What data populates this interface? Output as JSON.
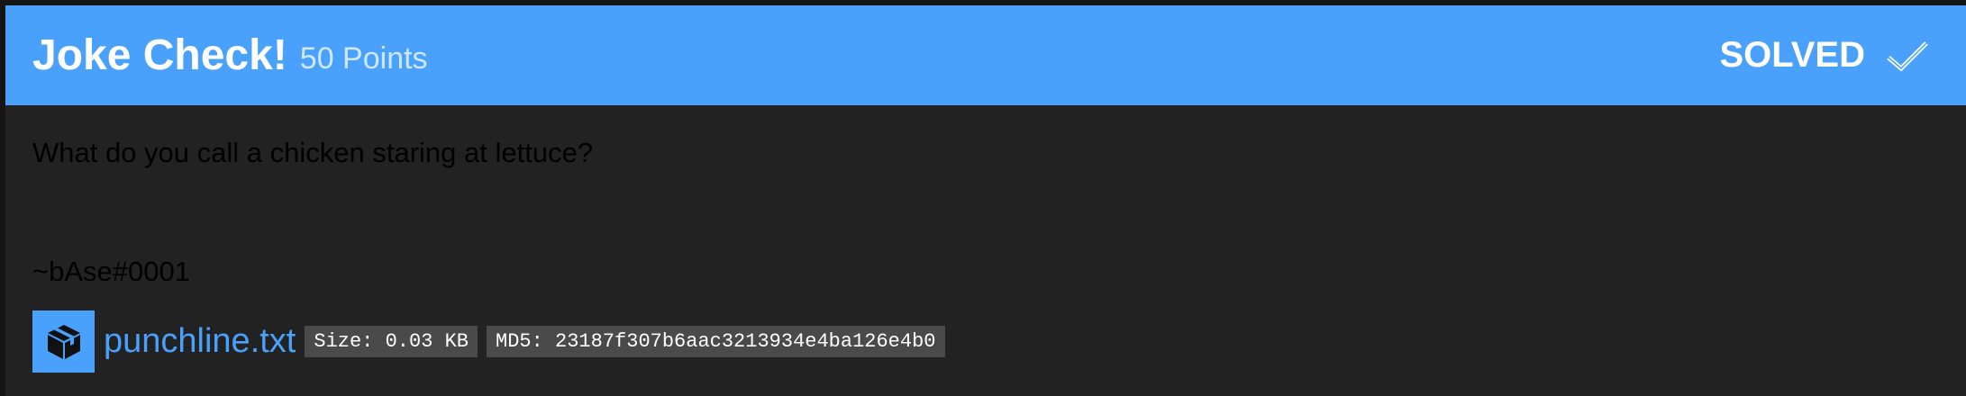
{
  "challenge": {
    "title": "Joke Check!",
    "points": "50 Points",
    "status": "SOLVED",
    "description": "What do you call a chicken staring at lettuce?",
    "author": "~bAse#0001"
  },
  "file": {
    "name": "punchline.txt",
    "size": "Size: 0.03 KB",
    "md5": "MD5: 23187f307b6aac3213934e4ba126e4b0"
  },
  "icons": {
    "status": "checkmark-icon",
    "file": "package-box-icon"
  },
  "colors": {
    "header": "#4aa1fb",
    "body": "#222222",
    "link": "#4aa1fb",
    "badge": "#4a4a4a"
  }
}
